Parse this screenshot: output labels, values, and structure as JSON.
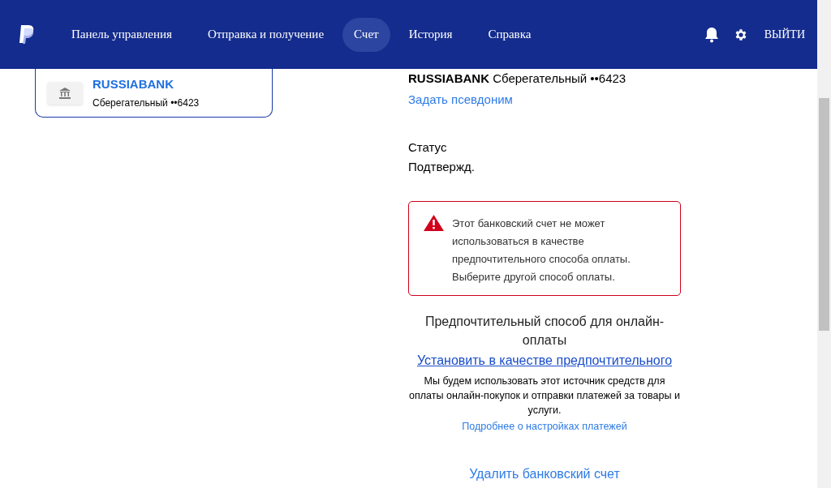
{
  "nav": {
    "items": [
      {
        "label": "Панель управления",
        "selected": false
      },
      {
        "label": "Отправка и получение",
        "selected": false
      },
      {
        "label": "Счет",
        "selected": true
      },
      {
        "label": "История",
        "selected": false
      },
      {
        "label": "Справка",
        "selected": false
      }
    ],
    "logout": "ВЫЙТИ"
  },
  "account_card": {
    "bank": "RUSSIABANK",
    "account": "Сберегательный ••6423",
    "selected": true
  },
  "details": {
    "heading": "**RUSSIABANK** Сберегательный ••6423",
    "nickname_link": "Задать псевдоним",
    "status_label": "Статус",
    "status_value": "Подтвержд.",
    "alert": "Этот банковский счет не может использоваться в качестве предпочтительного способа оплаты. Выберите другой способ оплаты.",
    "preferred_title": "Предпочтительный способ для онлайн-оплаты",
    "preferred_link": "Установить в качестве предпочтительного",
    "preferred_text": "Мы будем использовать этот источник средств для оплаты онлайн-покупок и отправки платежей за товары и услуги.",
    "settings_link": "Подробнее о настройках платежей",
    "delete_link": "Удалить банковский счет"
  }
}
